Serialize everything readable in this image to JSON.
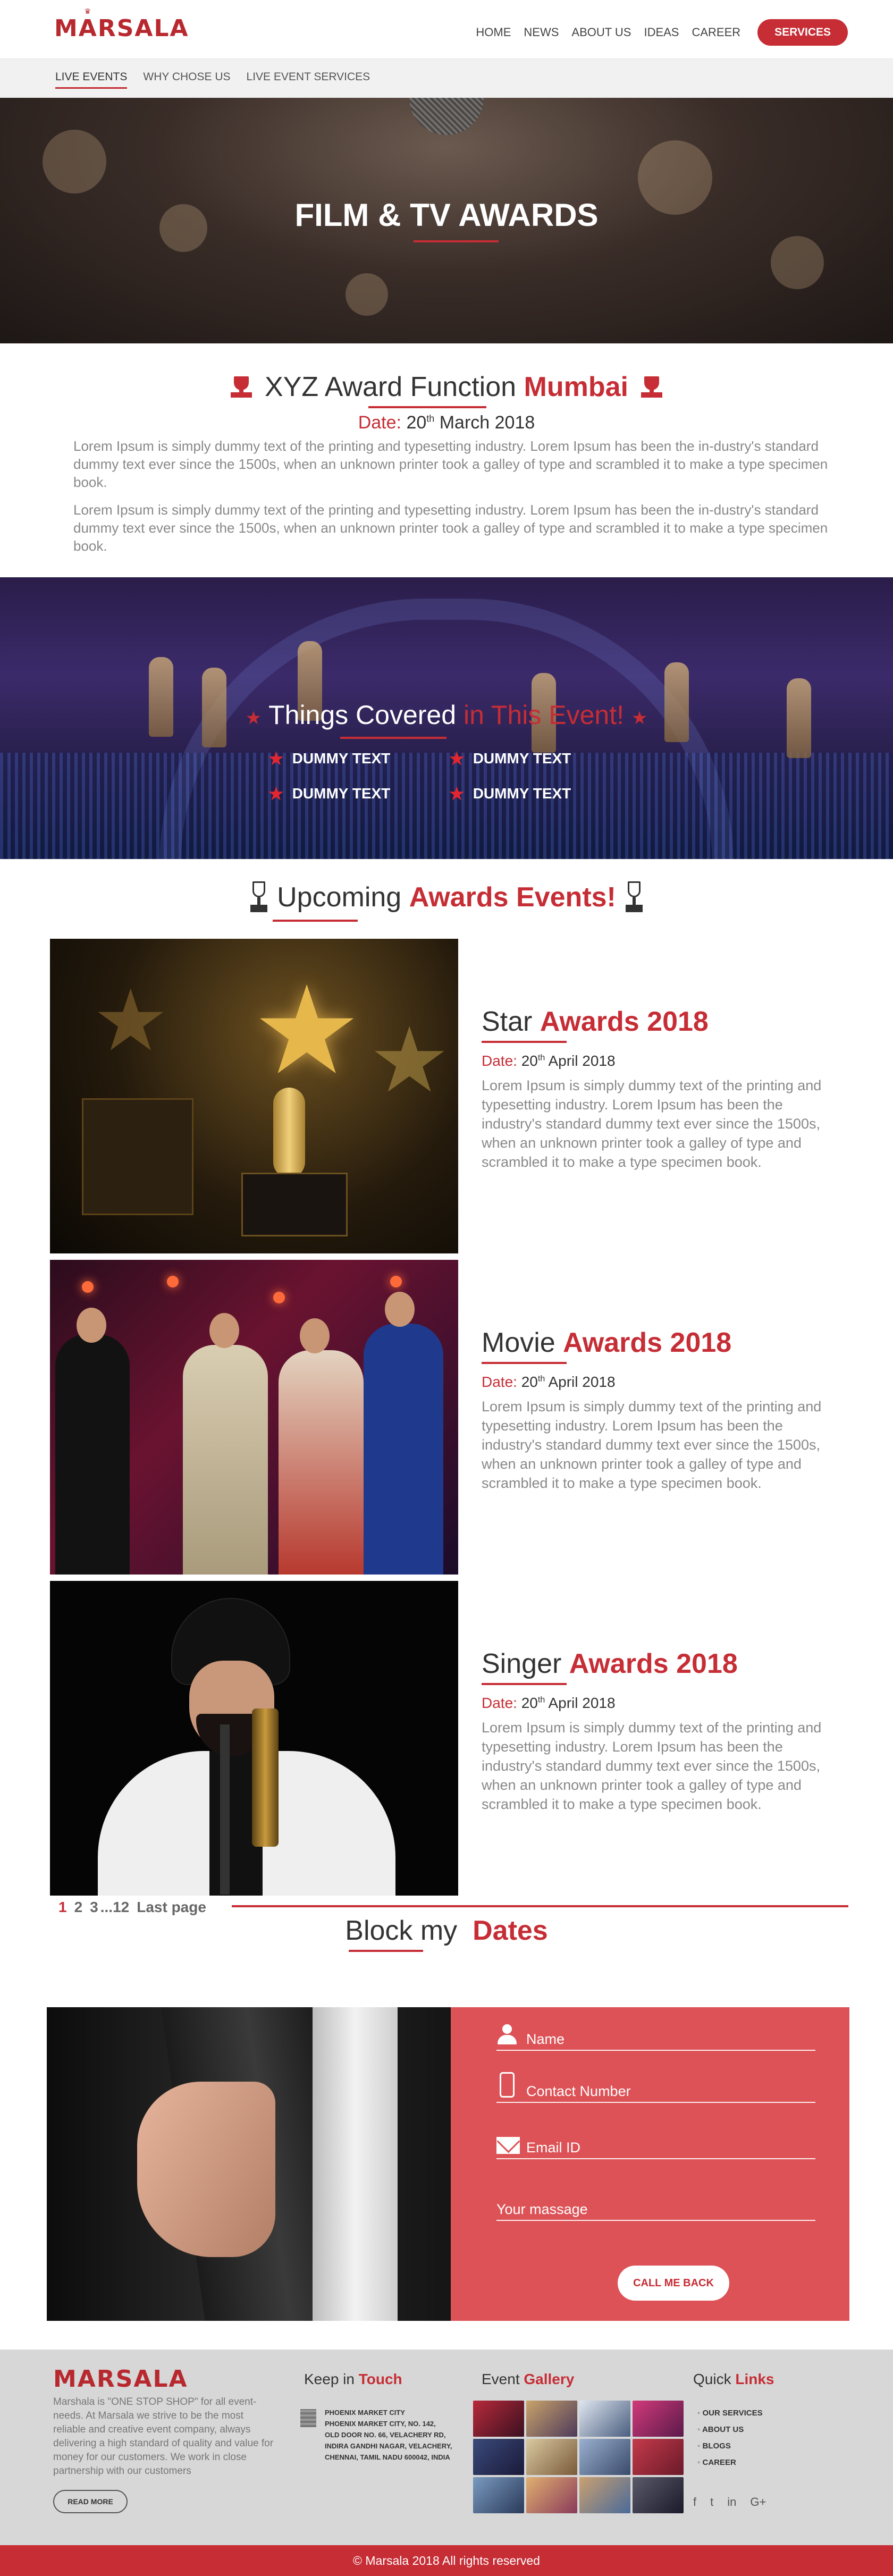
{
  "header": {
    "logo": "MARSALA",
    "nav": [
      "HOME",
      "NEWS",
      "ABOUT US",
      "IDEAS",
      "CAREER"
    ],
    "services_button": "SERVICES"
  },
  "subnav": {
    "items": [
      "LIVE EVENTS",
      "WHY CHOSE US",
      "LIVE EVENT SERVICES"
    ],
    "active_index": 0
  },
  "hero": {
    "title": "FILM & TV AWARDS"
  },
  "intro": {
    "title_plain": "XYZ Award Function",
    "title_accent": "Mumbai",
    "date_label": "Date:",
    "date_day": "20",
    "date_suffix": "th",
    "date_rest": "March 2018",
    "paragraph_1": "Lorem Ipsum is simply dummy text of the printing and typesetting industry. Lorem Ipsum has been the in-dustry's standard dummy text ever since the 1500s, when an unknown printer took a galley of type and scrambled it to make a type specimen book.",
    "paragraph_2": "Lorem Ipsum is simply dummy text of the printing and typesetting industry. Lorem Ipsum has been the in-dustry's standard dummy text ever since the 1500s, when an unknown printer took a galley of type and scrambled it to make a type specimen book."
  },
  "covered": {
    "title_plain": "Things Covered",
    "title_accent": "in This Event!",
    "items": [
      "DUMMY TEXT",
      "DUMMY TEXT",
      "DUMMY TEXT",
      "DUMMY TEXT"
    ]
  },
  "upcoming": {
    "title_plain": "Upcoming",
    "title_accent": "Awards Events!"
  },
  "events": [
    {
      "title_plain": "Star",
      "title_accent": "Awards 2018",
      "date_label": "Date:",
      "date_day": "20",
      "date_suffix": "th",
      "date_rest": "April 2018",
      "description": "Lorem Ipsum is simply dummy text of the printing and typesetting industry. Lorem Ipsum has been the industry's standard dummy text ever since the 1500s, when an unknown printer took a galley of type and scrambled it to make a type specimen book."
    },
    {
      "title_plain": "Movie",
      "title_accent": "Awards 2018",
      "date_label": "Date:",
      "date_day": "20",
      "date_suffix": "th",
      "date_rest": "April 2018",
      "description": "Lorem Ipsum is simply dummy text of the printing and typesetting industry. Lorem Ipsum has been the industry's standard dummy text ever since the 1500s, when an unknown printer took a galley of type and scrambled it to make a type specimen book."
    },
    {
      "title_plain": "Singer",
      "title_accent": "Awards 2018",
      "date_label": "Date:",
      "date_day": "20",
      "date_suffix": "th",
      "date_rest": "April 2018",
      "description": "Lorem Ipsum is simply dummy text of the printing and typesetting industry. Lorem Ipsum has been the industry's standard dummy text ever since the 1500s, when an unknown printer took a galley of type and scrambled it to make a type specimen book."
    }
  ],
  "pagination": {
    "pages": [
      "1",
      "2",
      "3",
      "...12"
    ],
    "current": "1",
    "last": "Last page"
  },
  "block_dates": {
    "title_plain": "Block my",
    "title_accent": "Dates",
    "fields": {
      "name": "Name",
      "contact": "Contact Number",
      "email": "Email ID",
      "message": "Your massage"
    },
    "button": "CALL ME BACK"
  },
  "footer": {
    "logo": "MARSALA",
    "about": "Marshala is \"ONE STOP SHOP\" for all event-needs. At Marsala we strive to be the most reliable and creative event company, always delivering a high standard of quality and value for money for our customers. We work in close partnership with our customers",
    "read_more": "READ MORE",
    "touch_title_plain": "Keep in",
    "touch_title_accent": "Touch",
    "address_lines": [
      "PHOENIX MARKET CITY",
      "PHOENIX MARKET CITY, NO. 142,",
      "OLD DOOR NO. 66, VELACHERY RD,",
      "INDIRA GANDHI NAGAR, VELACHERY,",
      "CHENNAI, TAMIL NADU 600042, INDIA"
    ],
    "gallery_title_plain": "Event",
    "gallery_title_accent": "Gallery",
    "links_title_plain": "Quick",
    "links_title_accent": "Links",
    "links": [
      "OUR SERVICES",
      "ABOUT US",
      "BLOGS",
      "CAREER"
    ],
    "social_icons": [
      "facebook-icon",
      "twitter-icon",
      "linkedin-icon",
      "google-plus-icon"
    ],
    "social_glyphs": [
      "f",
      "t",
      "in",
      "G+"
    ]
  },
  "copyright": "© Marsala 2018  All rights reserved",
  "colors": {
    "brand_red": "#c62d35",
    "form_red": "#dd5256",
    "footer_grey": "#d7d7d7"
  }
}
